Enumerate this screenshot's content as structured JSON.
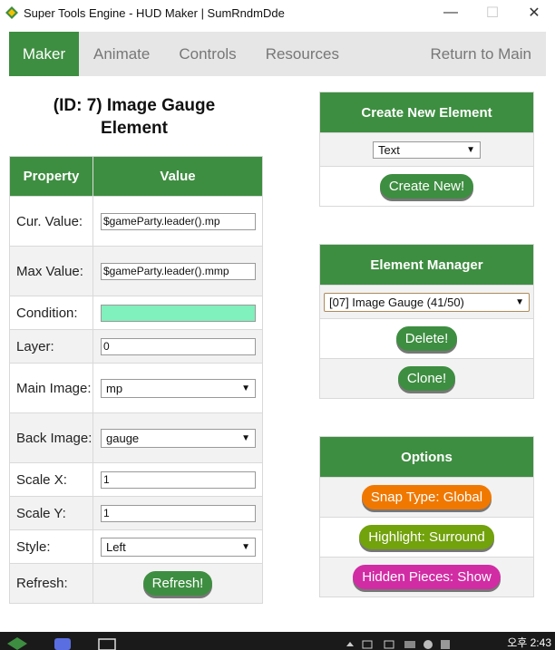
{
  "window": {
    "title": "Super Tools Engine  -  HUD Maker  |  SumRndmDde",
    "minimize": "—",
    "maximize": "☐",
    "close": "✕"
  },
  "nav": {
    "tabs": [
      "Maker",
      "Animate",
      "Controls",
      "Resources"
    ],
    "return": "Return to Main"
  },
  "heading": {
    "line1": "(ID: 7) Image Gauge",
    "line2": "Element"
  },
  "table": {
    "col_property": "Property",
    "col_value": "Value",
    "rows": {
      "cur_value": {
        "label": "Cur. Value:",
        "value": "$gameParty.leader().mp"
      },
      "max_value": {
        "label": "Max Value:",
        "value": "$gameParty.leader().mmp"
      },
      "condition": {
        "label": "Condition:",
        "value": ""
      },
      "layer": {
        "label": "Layer:",
        "value": "0"
      },
      "main_image": {
        "label": "Main Image:",
        "value": "mp"
      },
      "back_image": {
        "label": "Back Image:",
        "value": "gauge"
      },
      "scale_x": {
        "label": "Scale X:",
        "value": "1"
      },
      "scale_y": {
        "label": "Scale Y:",
        "value": "1"
      },
      "style": {
        "label": "Style:",
        "value": "Left"
      },
      "refresh": {
        "label": "Refresh:",
        "button": "Refresh!"
      }
    }
  },
  "create_panel": {
    "title": "Create New Element",
    "type_value": "Text",
    "button": "Create New!"
  },
  "manager_panel": {
    "title": "Element Manager",
    "selected": "[07] Image Gauge (41/50)",
    "delete": "Delete!",
    "clone": "Clone!"
  },
  "options_panel": {
    "title": "Options",
    "snap": "Snap Type: Global",
    "highlight": "Highlight: Surround",
    "hidden": "Hidden Pieces: Show"
  },
  "taskbar": {
    "clock": "오후 2:43"
  },
  "colors": {
    "accent_green": "#3e8e41",
    "snap_orange": "#f07800",
    "highlight_olive": "#72a20c",
    "hidden_magenta": "#d12ca4",
    "condition_fill": "#80f0bc"
  },
  "icons": {
    "app": "app-logo-icon",
    "caret": "▼"
  }
}
